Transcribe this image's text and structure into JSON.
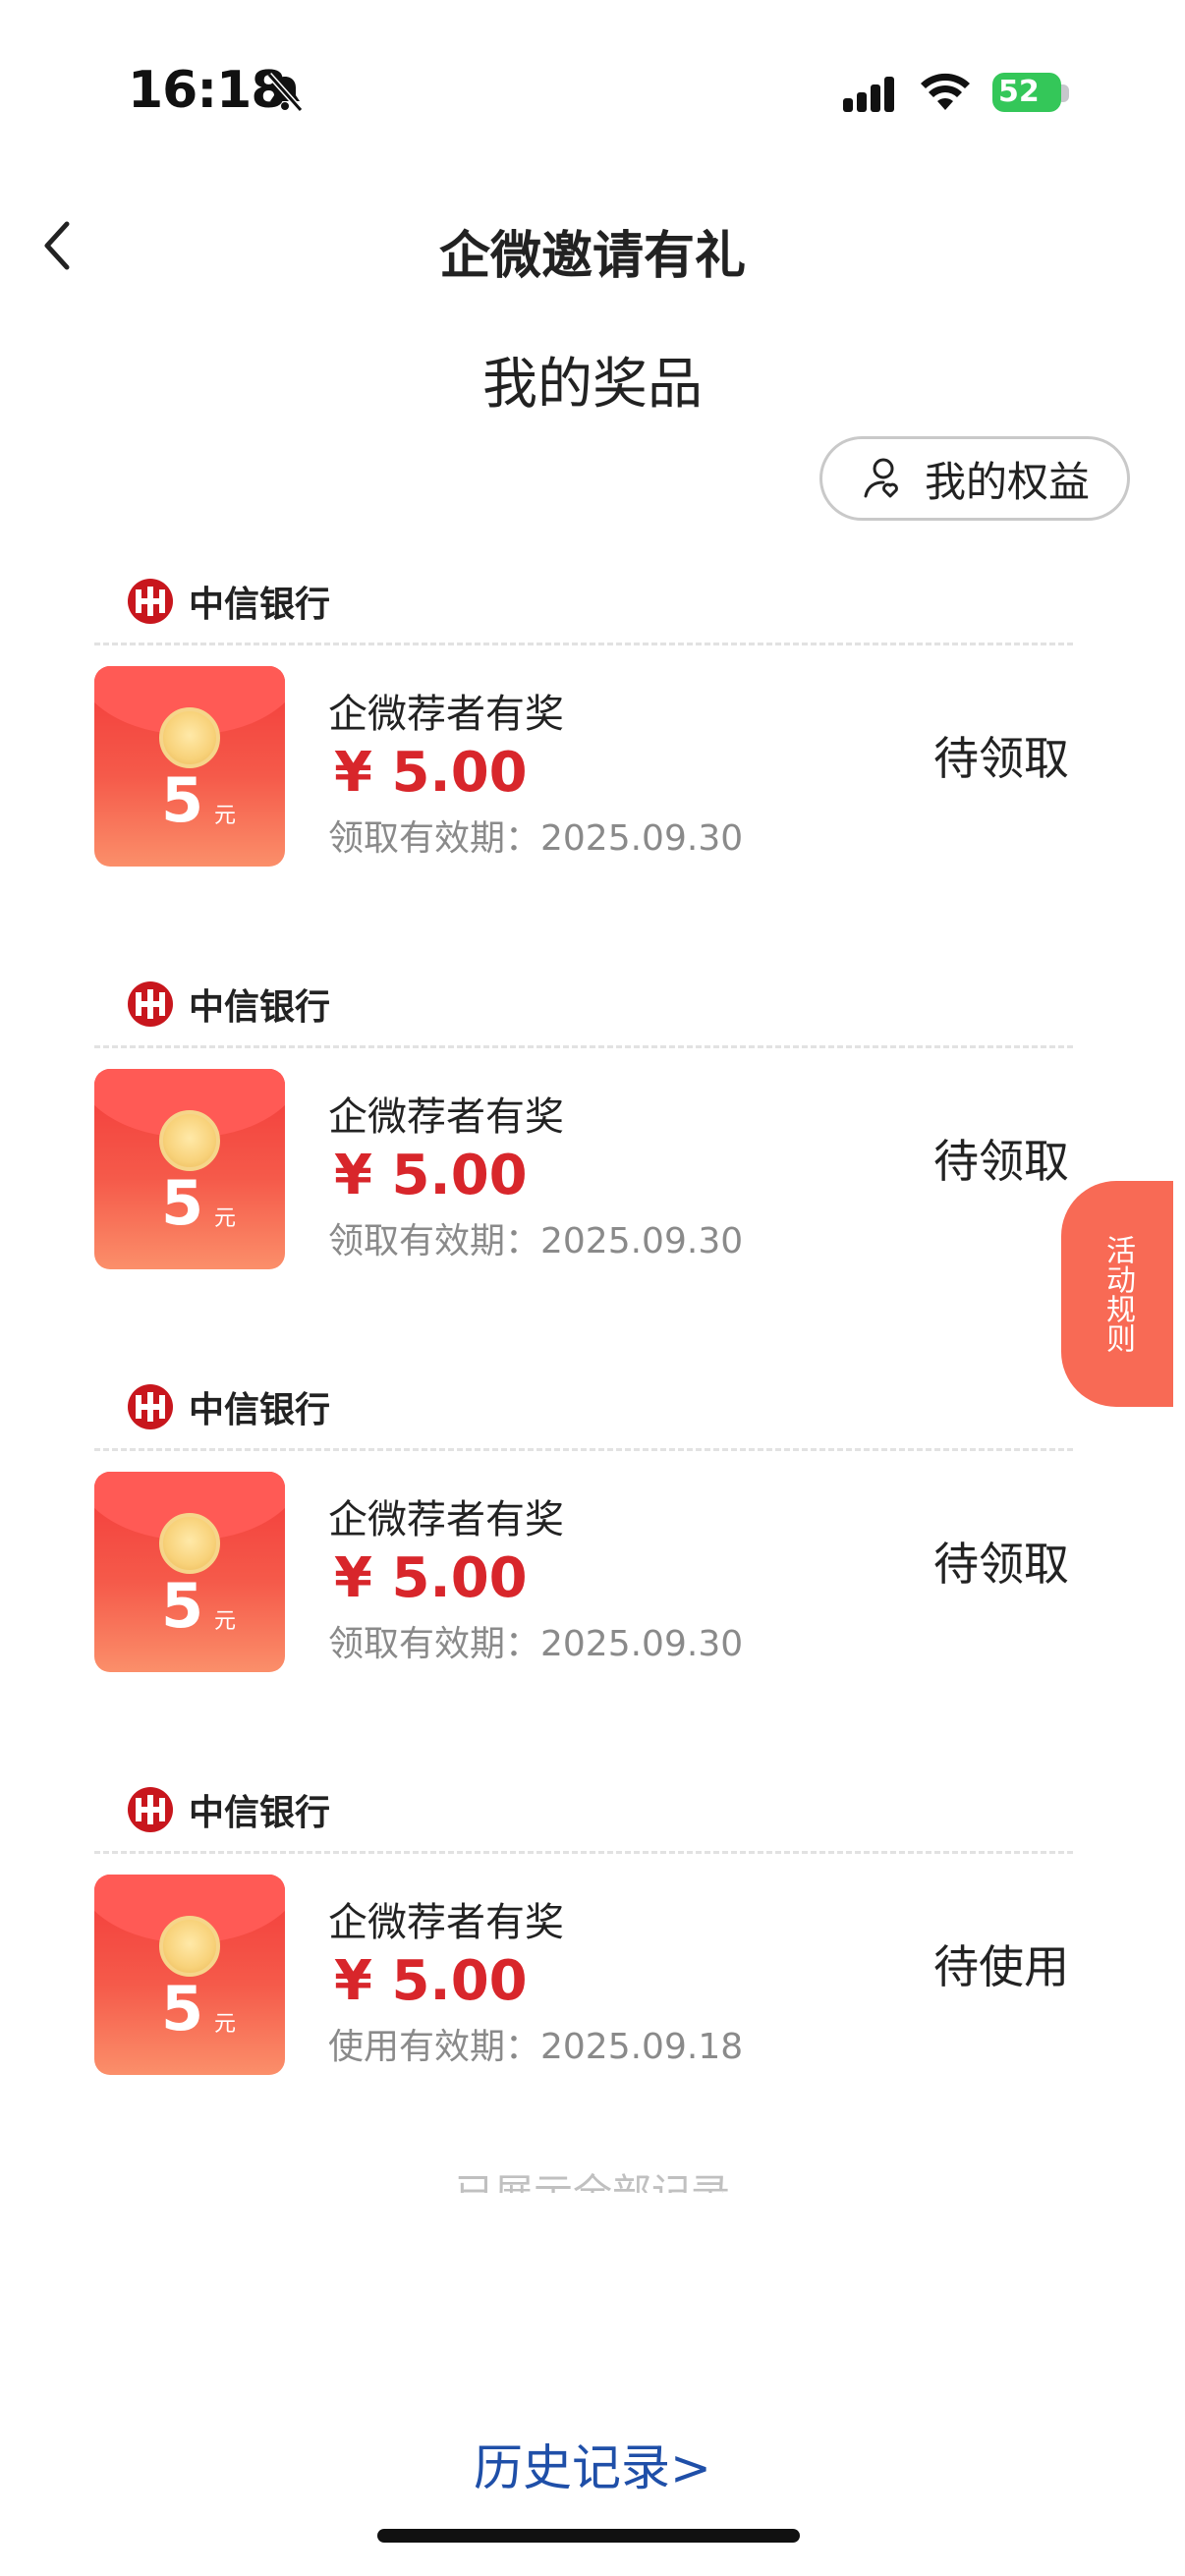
{
  "status_bar": {
    "time": "16:18",
    "battery": "52"
  },
  "nav": {
    "title": "企微邀请有礼"
  },
  "section": {
    "title": "我的奖品"
  },
  "benefits_button": {
    "label": "我的权益"
  },
  "prizes": [
    {
      "bank": "中信银行",
      "name": "企微荐者有奖",
      "amount": "¥ 5.00",
      "validity": "领取有效期：2025.09.30",
      "status": "待领取"
    },
    {
      "bank": "中信银行",
      "name": "企微荐者有奖",
      "amount": "¥ 5.00",
      "validity": "领取有效期：2025.09.30",
      "status": "待领取"
    },
    {
      "bank": "中信银行",
      "name": "企微荐者有奖",
      "amount": "¥ 5.00",
      "validity": "领取有效期：2025.09.30",
      "status": "待领取"
    },
    {
      "bank": "中信银行",
      "name": "企微荐者有奖",
      "amount": "¥ 5.00",
      "validity": "使用有效期：2025.09.18",
      "status": "待使用"
    }
  ],
  "envelope": {
    "amount": "5",
    "unit": "元"
  },
  "side_tab": {
    "label": "活动规则"
  },
  "footnote": "已展示全部记录",
  "history_link": "历史记录>",
  "colors": {
    "accent_red": "#d8262b",
    "side_tab": "#f86a55",
    "link_blue": "#1f4fa8",
    "battery_green": "#34c759"
  },
  "icons": [
    "bell-slash-icon",
    "signal-icon",
    "wifi-icon",
    "battery-icon",
    "back-icon",
    "user-heart-icon",
    "citic-logo-icon"
  ]
}
